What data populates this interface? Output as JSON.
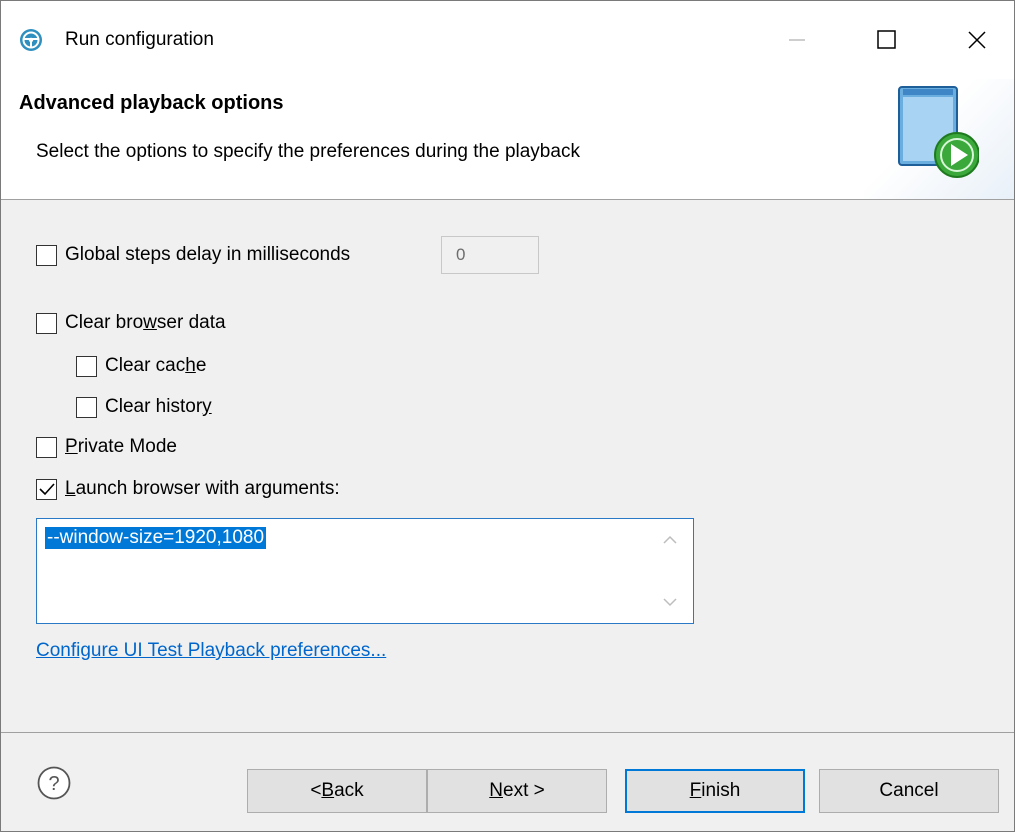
{
  "window": {
    "title": "Run configuration",
    "controls": {
      "minimize": "minimize",
      "maximize": "maximize",
      "close": "close"
    }
  },
  "banner": {
    "title": "Advanced playback options",
    "description": "Select the options to specify the preferences during the playback"
  },
  "options": {
    "global_delay": {
      "label": "Global steps delay in milliseconds",
      "checked": false,
      "value": "0"
    },
    "clear_browser_data": {
      "label_pre": "Clear bro",
      "label_u": "w",
      "label_post": "ser data",
      "checked": false
    },
    "clear_cache": {
      "label_pre": "Clear cac",
      "label_u": "h",
      "label_post": "e",
      "checked": false
    },
    "clear_history": {
      "label_pre": "Clear histor",
      "label_u": "y",
      "label_post": "",
      "checked": false
    },
    "private_mode": {
      "label_pre": "",
      "label_u": "P",
      "label_post": "rivate Mode",
      "checked": false
    },
    "launch_args": {
      "label_pre": "",
      "label_u": "L",
      "label_post": "aunch browser with arguments:",
      "checked": true
    }
  },
  "arguments_text": "--window-size=1920,1080",
  "prefs_link": "Configure UI Test Playback preferences...",
  "footer": {
    "back": {
      "pre": "< ",
      "u": "B",
      "post": "ack"
    },
    "next": {
      "pre": "",
      "u": "N",
      "post": "ext >"
    },
    "finish": {
      "pre": "",
      "u": "F",
      "post": "inish"
    },
    "cancel": "Cancel"
  },
  "colors": {
    "accent": "#0078d7",
    "link": "#0066cc",
    "icon_green": "#3aa83a"
  }
}
